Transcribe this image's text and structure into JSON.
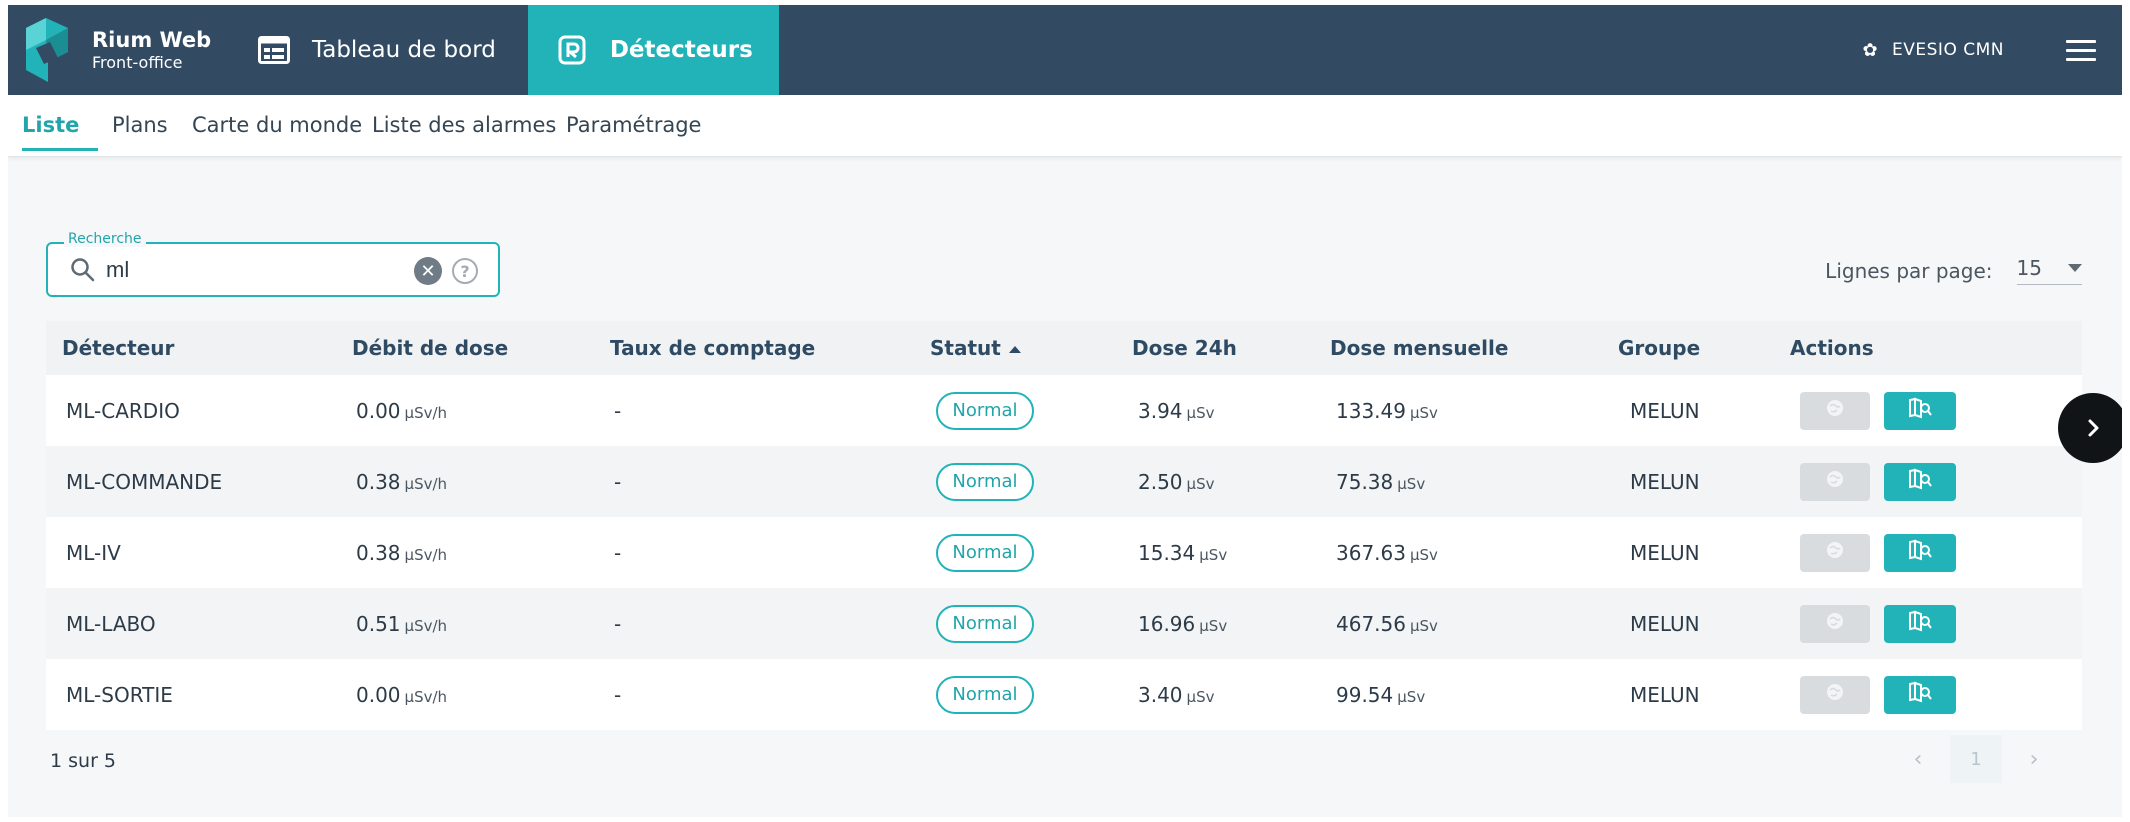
{
  "app": {
    "name": "Rium Web",
    "subtitle": "Front-office"
  },
  "topnav": {
    "items": [
      {
        "label": "Tableau de bord",
        "icon": "dashboard-icon",
        "active": false
      },
      {
        "label": "Détecteurs",
        "icon": "detector-icon",
        "active": true
      }
    ],
    "organization": "EVESIO CMN"
  },
  "subnav": {
    "tabs": [
      {
        "label": "Liste",
        "active": true
      },
      {
        "label": "Plans",
        "active": false
      },
      {
        "label": "Carte du monde",
        "active": false
      },
      {
        "label": "Liste des alarmes",
        "active": false
      },
      {
        "label": "Paramétrage",
        "active": false
      }
    ]
  },
  "search": {
    "legend": "Recherche",
    "value": "ml"
  },
  "pagination": {
    "rows_per_page_label": "Lignes par page:",
    "rows_per_page": "15",
    "summary": "1 sur 5",
    "current_page": "1"
  },
  "table": {
    "columns": [
      "Détecteur",
      "Débit de dose",
      "Taux de comptage",
      "Statut",
      "Dose 24h",
      "Dose mensuelle",
      "Groupe",
      "Actions"
    ],
    "rows": [
      {
        "detector": "ML-CARDIO",
        "dose_rate": "0.00",
        "dose_rate_unit": "µSv/h",
        "count_rate": "-",
        "status": "Normal",
        "dose_24h": "3.94",
        "dose_24h_unit": "µSv",
        "dose_month": "133.49",
        "dose_month_unit": "µSv",
        "group": "MELUN"
      },
      {
        "detector": "ML-COMMANDE",
        "dose_rate": "0.38",
        "dose_rate_unit": "µSv/h",
        "count_rate": "-",
        "status": "Normal",
        "dose_24h": "2.50",
        "dose_24h_unit": "µSv",
        "dose_month": "75.38",
        "dose_month_unit": "µSv",
        "group": "MELUN"
      },
      {
        "detector": "ML-IV",
        "dose_rate": "0.38",
        "dose_rate_unit": "µSv/h",
        "count_rate": "-",
        "status": "Normal",
        "dose_24h": "15.34",
        "dose_24h_unit": "µSv",
        "dose_month": "367.63",
        "dose_month_unit": "µSv",
        "group": "MELUN"
      },
      {
        "detector": "ML-LABO",
        "dose_rate": "0.51",
        "dose_rate_unit": "µSv/h",
        "count_rate": "-",
        "status": "Normal",
        "dose_24h": "16.96",
        "dose_24h_unit": "µSv",
        "dose_month": "467.56",
        "dose_month_unit": "µSv",
        "group": "MELUN"
      },
      {
        "detector": "ML-SORTIE",
        "dose_rate": "0.00",
        "dose_rate_unit": "µSv/h",
        "count_rate": "-",
        "status": "Normal",
        "dose_24h": "3.40",
        "dose_24h_unit": "µSv",
        "dose_month": "99.54",
        "dose_month_unit": "µSv",
        "group": "MELUN"
      }
    ]
  },
  "colors": {
    "topbar": "#324b63",
    "accent": "#21b3b8",
    "text": "#2d3b48"
  }
}
